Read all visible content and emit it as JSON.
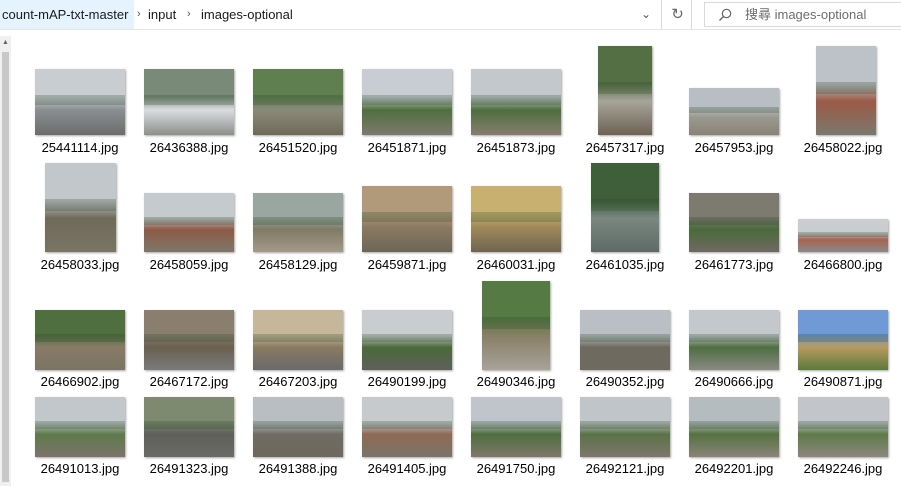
{
  "addressbar": {
    "crumbs": [
      "count-mAP-txt-master",
      "input",
      "images-optional"
    ],
    "separator": "›",
    "dropdown_glyph": "⌄",
    "refresh_glyph": "↻"
  },
  "search": {
    "placeholder": "搜尋 images-optional",
    "value": ""
  },
  "files": [
    {
      "name": "25441114.jpg",
      "colors": [
        "#c9ccd0",
        "#8b8f92",
        "#6b6c6a"
      ]
    },
    {
      "name": "26436388.jpg",
      "colors": [
        "#7a8a78",
        "#d9dde0",
        "#8d8f8a"
      ]
    },
    {
      "name": "26451520.jpg",
      "colors": [
        "#5f7f4f",
        "#8a8a7a",
        "#6f6a58"
      ]
    },
    {
      "name": "26451871.jpg",
      "colors": [
        "#c7cdd2",
        "#4f6f3f",
        "#7d7a6e"
      ]
    },
    {
      "name": "26451873.jpg",
      "colors": [
        "#c3c8cc",
        "#4e6e40",
        "#857e6e"
      ]
    },
    {
      "name": "26457317.jpg",
      "colors": [
        "#556f44",
        "#a7a499",
        "#6e6254"
      ]
    },
    {
      "name": "26457953.jpg",
      "colors": [
        "#b8bec4",
        "#9a9a90",
        "#8a8276"
      ]
    },
    {
      "name": "26458022.jpg",
      "colors": [
        "#bcc2c8",
        "#9b5a45",
        "#7b786e"
      ]
    },
    {
      "name": "26458033.jpg",
      "colors": [
        "#c2c7cc",
        "#6f6a5a",
        "#7a7464"
      ]
    },
    {
      "name": "26458059.jpg",
      "colors": [
        "#c5cacf",
        "#8d5a45",
        "#7d776a"
      ]
    },
    {
      "name": "26458129.jpg",
      "colors": [
        "#9aa6a0",
        "#7f7a66",
        "#a49a88"
      ]
    },
    {
      "name": "26459871.jpg",
      "colors": [
        "#b09a7a",
        "#8c7a62",
        "#6c6656"
      ]
    },
    {
      "name": "26460031.jpg",
      "colors": [
        "#c8b070",
        "#a08a5a",
        "#6f6450"
      ]
    },
    {
      "name": "26461035.jpg",
      "colors": [
        "#3f5f3a",
        "#7a8880",
        "#5f6a66"
      ]
    },
    {
      "name": "26461773.jpg",
      "colors": [
        "#7d7a70",
        "#4a6a3a",
        "#6f6a62"
      ]
    },
    {
      "name": "26466800.jpg",
      "colors": [
        "#c9ccd0",
        "#a76450",
        "#8a8a8a"
      ]
    },
    {
      "name": "26466902.jpg",
      "colors": [
        "#4f6f3f",
        "#8a7a66",
        "#7a7464"
      ]
    },
    {
      "name": "26467172.jpg",
      "colors": [
        "#8a7f6e",
        "#6a5f50",
        "#7a7a7a"
      ]
    },
    {
      "name": "26467203.jpg",
      "colors": [
        "#c7b79a",
        "#8a7a62",
        "#6a6a6a"
      ]
    },
    {
      "name": "26490199.jpg",
      "colors": [
        "#c9cdd0",
        "#4a6a3a",
        "#5f5f5a"
      ]
    },
    {
      "name": "26490346.jpg",
      "colors": [
        "#567a44",
        "#8a7f66",
        "#a8a29a"
      ]
    },
    {
      "name": "26490352.jpg",
      "colors": [
        "#b9bfc4",
        "#6e6a60",
        "#6f6a60"
      ]
    },
    {
      "name": "26490666.jpg",
      "colors": [
        "#c2c8cc",
        "#4e6e40",
        "#8a8a84"
      ]
    },
    {
      "name": "26490871.jpg",
      "colors": [
        "#6f9ad6",
        "#b89a60",
        "#5a7a3a"
      ]
    },
    {
      "name": "26491013.jpg",
      "colors": [
        "#c2c7cb",
        "#5e7a4c",
        "#7c7468"
      ]
    },
    {
      "name": "26491323.jpg",
      "colors": [
        "#7d8a70",
        "#5e5f5a",
        "#6a6a66"
      ]
    },
    {
      "name": "26491388.jpg",
      "colors": [
        "#b9bec3",
        "#6f6c62",
        "#6e685e"
      ]
    },
    {
      "name": "26491405.jpg",
      "colors": [
        "#c6cacd",
        "#8e6a56",
        "#7a7468"
      ]
    },
    {
      "name": "26491750.jpg",
      "colors": [
        "#bfc5ca",
        "#4e6e40",
        "#80786a"
      ]
    },
    {
      "name": "26492121.jpg",
      "colors": [
        "#c0c5c9",
        "#5a7248",
        "#7e776b"
      ]
    },
    {
      "name": "26492201.jpg",
      "colors": [
        "#b4bcc0",
        "#567242",
        "#8a8478"
      ]
    },
    {
      "name": "26492246.jpg",
      "colors": [
        "#c2c6ca",
        "#5e7a4a",
        "#8c877c"
      ]
    }
  ]
}
